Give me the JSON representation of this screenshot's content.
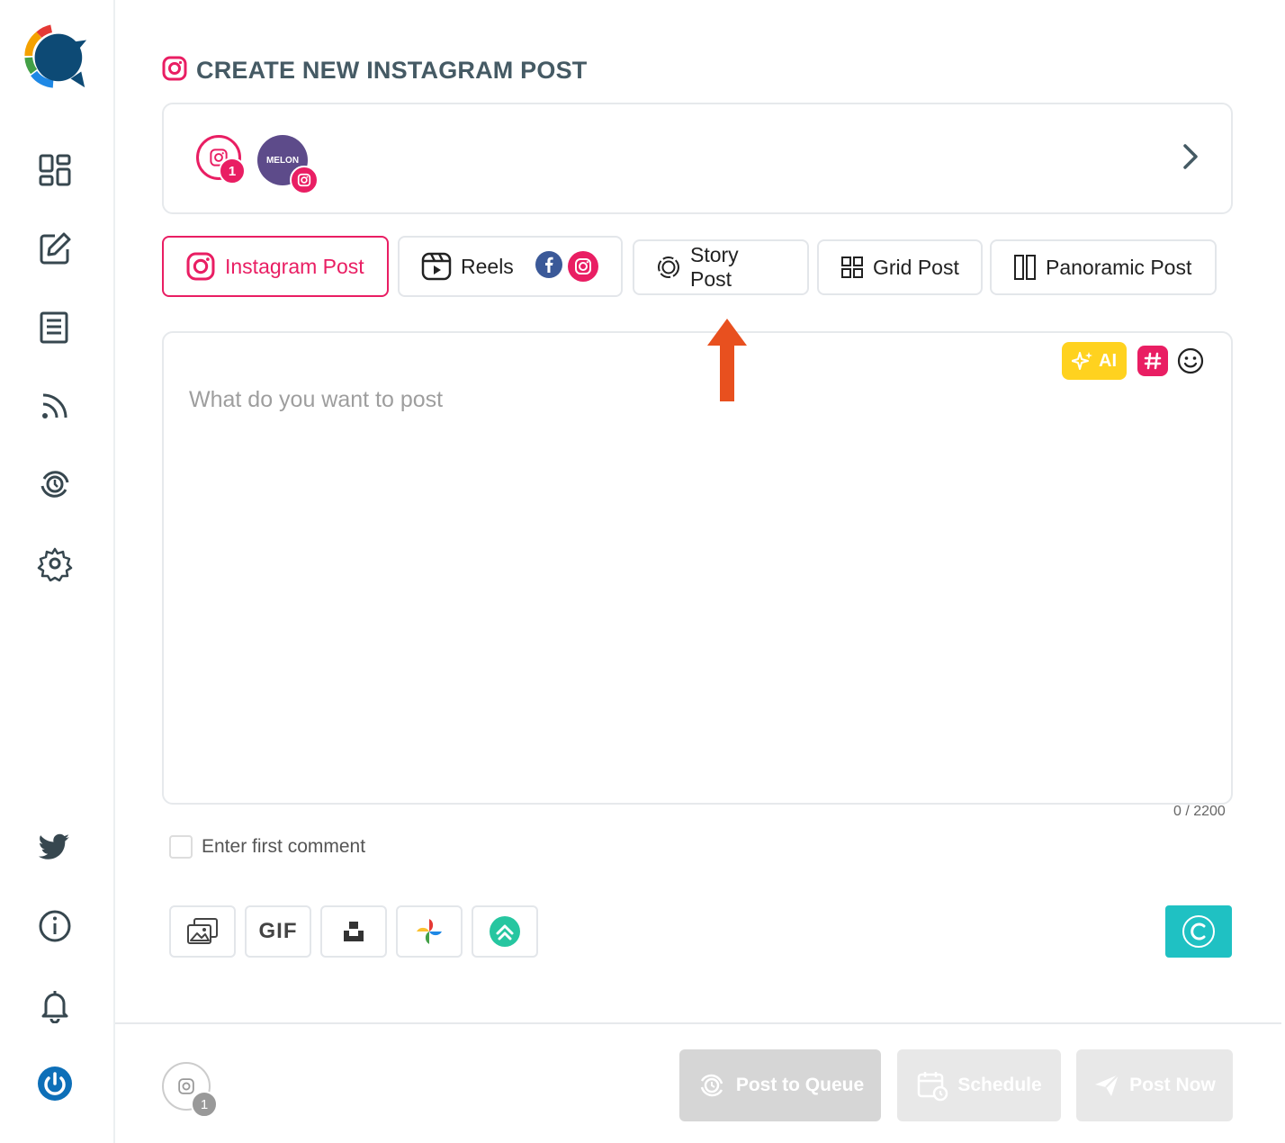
{
  "page": {
    "title": "CREATE NEW INSTAGRAM POST"
  },
  "accounts": {
    "selected_count": "1",
    "avatar_text": "MELON"
  },
  "tabs": [
    {
      "label": "Instagram Post"
    },
    {
      "label": "Reels"
    },
    {
      "label": "Story Post"
    },
    {
      "label": "Grid Post"
    },
    {
      "label": "Panoramic Post"
    }
  ],
  "composer": {
    "placeholder": "What do you want to post",
    "ai_label": "AI",
    "counter": "0 / 2200"
  },
  "first_comment": {
    "label": "Enter first comment"
  },
  "media": {
    "gif_label": "GIF"
  },
  "footer": {
    "account_count": "1",
    "post_to_queue": "Post to Queue",
    "schedule": "Schedule",
    "post_now": "Post Now"
  },
  "colors": {
    "accent": "#e91e63",
    "ai": "#ffd21f",
    "canva": "#1fc1c3",
    "title": "#455a64",
    "arrow": "#e8501f"
  }
}
